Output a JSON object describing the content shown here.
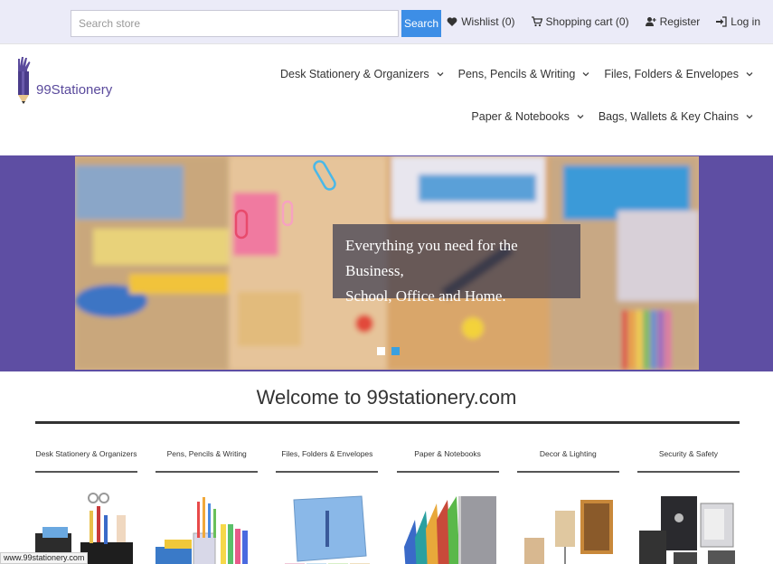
{
  "topbar": {
    "search_placeholder": "Search store",
    "search_button": "Search",
    "links": {
      "wishlist": "Wishlist (0)",
      "cart": "Shopping cart (0)",
      "register": "Register",
      "login": "Log in"
    }
  },
  "header": {
    "logo_text": "99Stationery",
    "nav": [
      {
        "label": "Desk Stationery & Organizers"
      },
      {
        "label": "Pens, Pencils & Writing"
      },
      {
        "label": "Files, Folders & Envelopes"
      },
      {
        "label": "Paper & Notebooks"
      },
      {
        "label": "Bags, Wallets & Key Chains"
      }
    ]
  },
  "banner": {
    "caption_line1": "Everything you need for the Business,",
    "caption_line2": "School, Office and Home."
  },
  "welcome": "Welcome to 99stationery.com",
  "categories": [
    {
      "label": "Desk Stationery & Organizers"
    },
    {
      "label": "Pens, Pencils & Writing"
    },
    {
      "label": "Files, Folders & Envelopes"
    },
    {
      "label": "Paper & Notebooks"
    },
    {
      "label": "Decor & Lighting"
    },
    {
      "label": "Security & Safety"
    }
  ],
  "status_url": "www.99stationery.com",
  "colors": {
    "topbar_bg": "#ebebf8",
    "banner_bg": "#5e4ea3",
    "search_button": "#3d8ee6",
    "brand": "#5a4a9c"
  }
}
